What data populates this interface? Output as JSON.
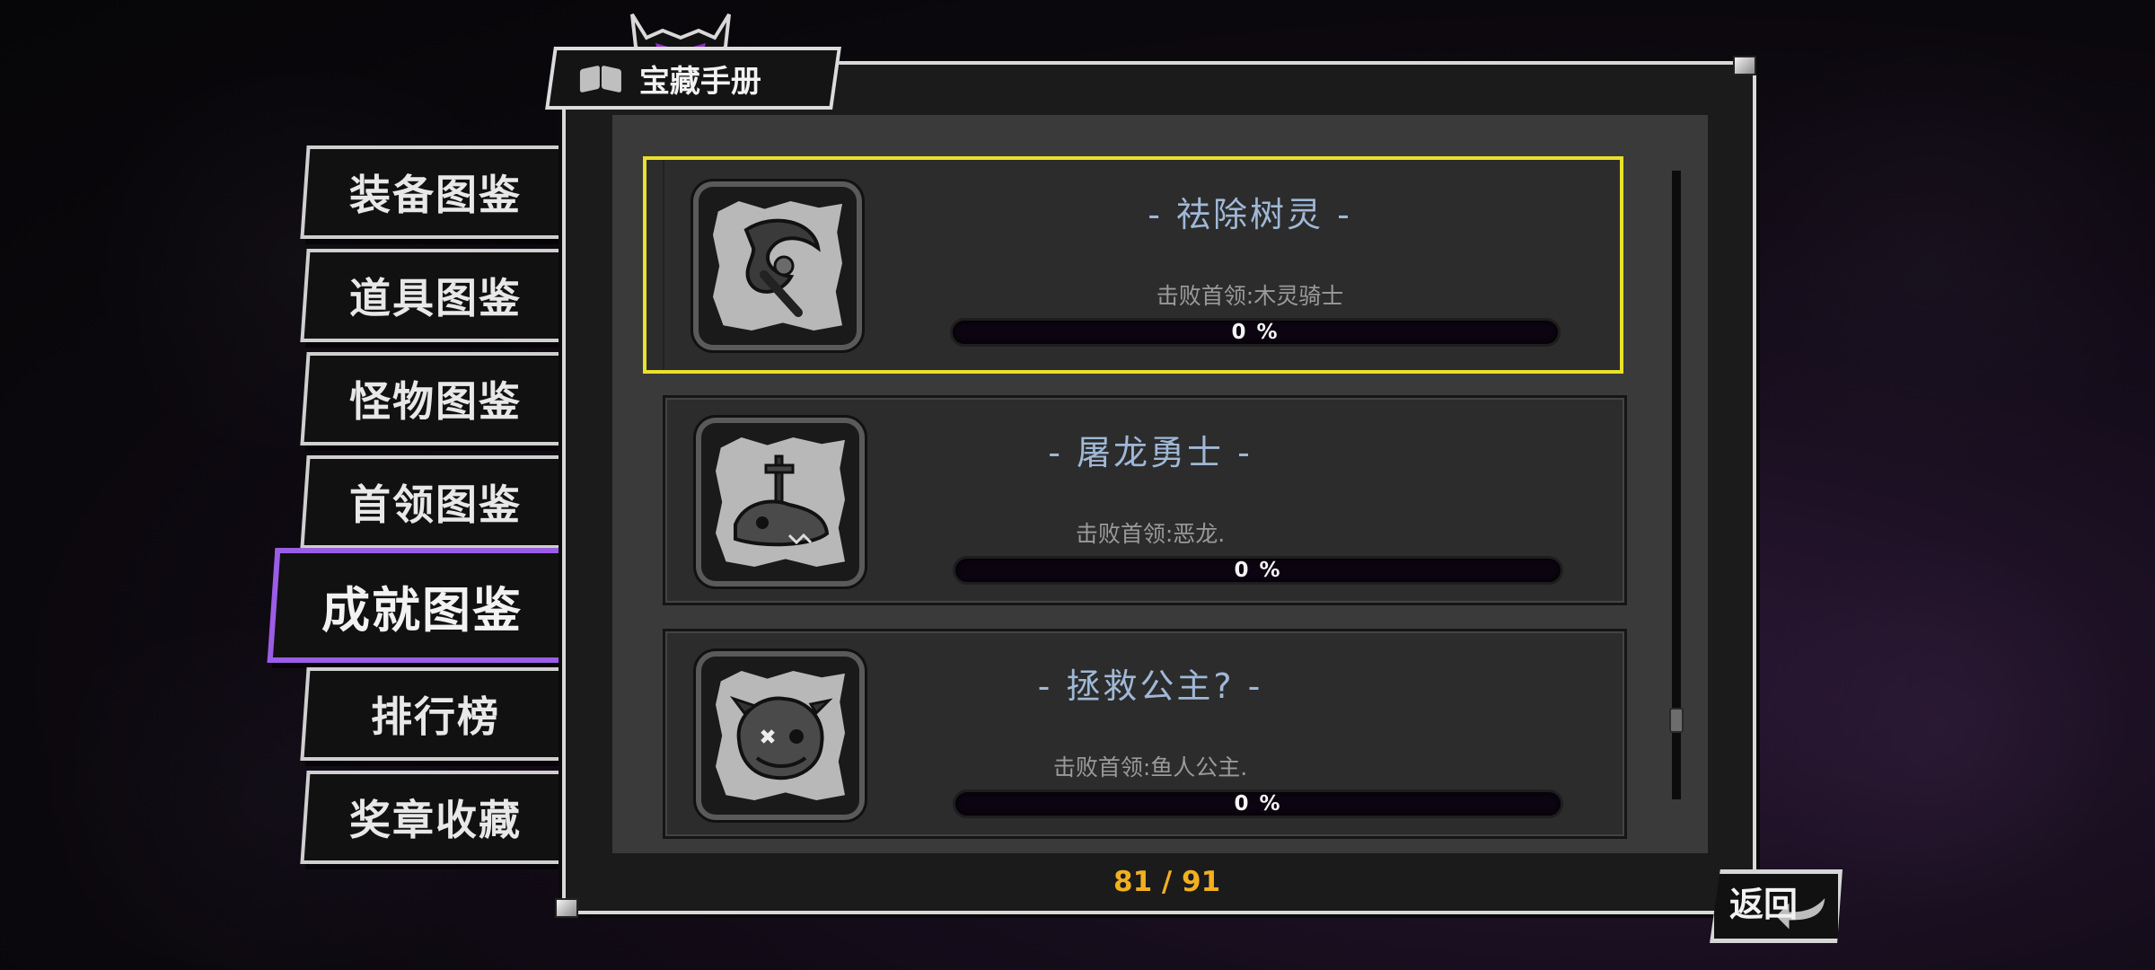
{
  "window": {
    "title": "宝藏手册"
  },
  "nav": {
    "items": [
      {
        "label": "装备图鉴",
        "active": false
      },
      {
        "label": "道具图鉴",
        "active": false
      },
      {
        "label": "怪物图鉴",
        "active": false
      },
      {
        "label": "首领图鉴",
        "active": false
      },
      {
        "label": "成就图鉴",
        "active": true
      },
      {
        "label": "排行榜",
        "active": false
      },
      {
        "label": "奖章收藏",
        "active": false
      }
    ]
  },
  "achievements": [
    {
      "title": "- 祛除树灵 -",
      "description": "击败首领:木灵骑士",
      "progress_text": "0 %",
      "progress": 0,
      "icon": "scythe-icon",
      "selected": true
    },
    {
      "title": "- 屠龙勇士 -",
      "description": "击败首领:恶龙.",
      "progress_text": "0 %",
      "progress": 0,
      "icon": "dragon-skull-sword-icon",
      "selected": false
    },
    {
      "title": "- 拯救公主? -",
      "description": "击败首领:鱼人公主.",
      "progress_text": "0 %",
      "progress": 0,
      "icon": "fish-princess-icon",
      "selected": false
    }
  ],
  "pagination": {
    "counter": "81 / 91"
  },
  "scrollbar": {
    "position": 0.89
  },
  "back_button": {
    "label": "返回"
  },
  "colors": {
    "active_nav_border": "#9b5de5",
    "selected_card_border": "#e9e12b",
    "counter": "#f0b020",
    "achievement_title": "#9fb8d6"
  }
}
